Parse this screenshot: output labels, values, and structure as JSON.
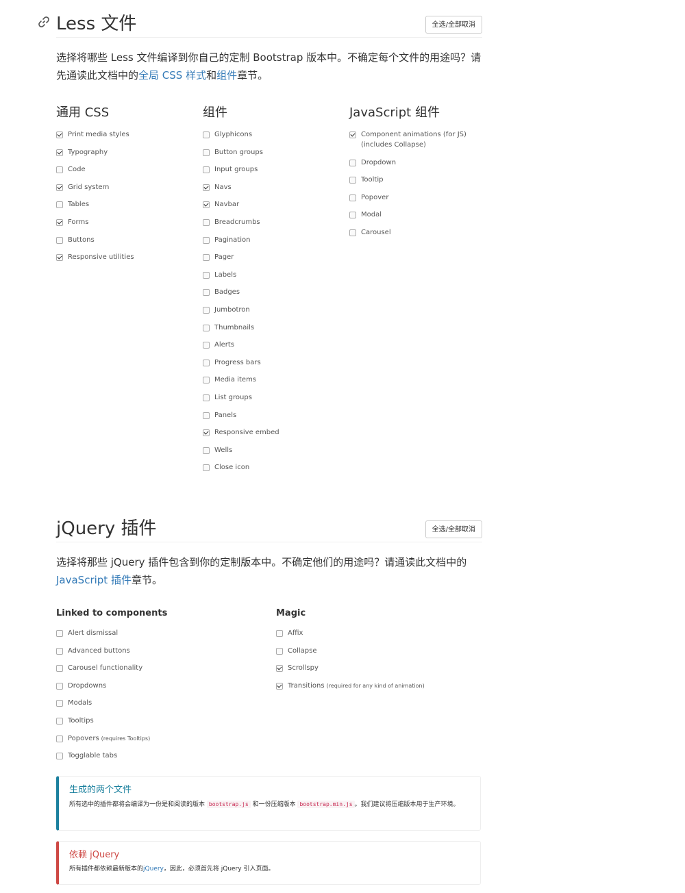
{
  "less": {
    "title": "Less 文件",
    "toggle_label": "全选/全部取消",
    "lead_pre": "选择将哪些 Less 文件编译到你自己的定制 Bootstrap 版本中。不确定每个文件的用途吗？请先通读此文档中的",
    "lead_link1": "全局 CSS 样式",
    "lead_mid": "和",
    "lead_link2": "组件",
    "lead_post": "章节。",
    "columns": [
      {
        "heading": "通用 CSS",
        "items": [
          {
            "label": "Print media styles",
            "checked": true
          },
          {
            "label": "Typography",
            "checked": true
          },
          {
            "label": "Code",
            "checked": false
          },
          {
            "label": "Grid system",
            "checked": true
          },
          {
            "label": "Tables",
            "checked": false
          },
          {
            "label": "Forms",
            "checked": true
          },
          {
            "label": "Buttons",
            "checked": false
          },
          {
            "label": "Responsive utilities",
            "checked": true
          }
        ]
      },
      {
        "heading": "组件",
        "items": [
          {
            "label": "Glyphicons",
            "checked": false
          },
          {
            "label": "Button groups",
            "checked": false
          },
          {
            "label": "Input groups",
            "checked": false
          },
          {
            "label": "Navs",
            "checked": true
          },
          {
            "label": "Navbar",
            "checked": true
          },
          {
            "label": "Breadcrumbs",
            "checked": false
          },
          {
            "label": "Pagination",
            "checked": false
          },
          {
            "label": "Pager",
            "checked": false
          },
          {
            "label": "Labels",
            "checked": false
          },
          {
            "label": "Badges",
            "checked": false
          },
          {
            "label": "Jumbotron",
            "checked": false
          },
          {
            "label": "Thumbnails",
            "checked": false
          },
          {
            "label": "Alerts",
            "checked": false
          },
          {
            "label": "Progress bars",
            "checked": false
          },
          {
            "label": "Media items",
            "checked": false
          },
          {
            "label": "List groups",
            "checked": false
          },
          {
            "label": "Panels",
            "checked": false
          },
          {
            "label": "Responsive embed",
            "checked": true
          },
          {
            "label": "Wells",
            "checked": false
          },
          {
            "label": "Close icon",
            "checked": false
          }
        ]
      },
      {
        "heading": "JavaScript 组件",
        "items": [
          {
            "label": "Component animations (for JS)",
            "label2": "(includes Collapse)",
            "checked": true
          },
          {
            "label": "Dropdown",
            "checked": false
          },
          {
            "label": "Tooltip",
            "checked": false
          },
          {
            "label": "Popover",
            "checked": false
          },
          {
            "label": "Modal",
            "checked": false
          },
          {
            "label": "Carousel",
            "checked": false
          }
        ]
      }
    ]
  },
  "jquery": {
    "title": "jQuery 插件",
    "toggle_label": "全选/全部取消",
    "lead_pre": "选择将那些 jQuery 插件包含到你的定制版本中。不确定他们的用途吗？请通读此文档中的",
    "lead_link": "JavaScript 插件",
    "lead_post": "章节。",
    "columns": [
      {
        "heading": "Linked to components",
        "items": [
          {
            "label": "Alert dismissal",
            "checked": false
          },
          {
            "label": "Advanced buttons",
            "checked": false
          },
          {
            "label": "Carousel functionality",
            "checked": false
          },
          {
            "label": "Dropdowns",
            "checked": false
          },
          {
            "label": "Modals",
            "checked": false
          },
          {
            "label": "Tooltips",
            "checked": false
          },
          {
            "label": "Popovers",
            "note": "(requires Tooltips)",
            "checked": false
          },
          {
            "label": "Togglable tabs",
            "checked": false
          }
        ]
      },
      {
        "heading": "Magic",
        "items": [
          {
            "label": "Affix",
            "checked": false
          },
          {
            "label": "Collapse",
            "checked": false
          },
          {
            "label": "Scrollspy",
            "checked": true
          },
          {
            "label": "Transitions",
            "note": "(required for any kind of animation)",
            "checked": true
          }
        ]
      }
    ]
  },
  "callout_info": {
    "title": "生成的两个文件",
    "text_pre": "所有选中的插件都将会编译为一份是和阅读的版本",
    "code1": "bootstrap.js",
    "text_mid": "和一份压缩版本",
    "code2": "bootstrap.min.js",
    "text_post": "。我们建议将压缩版本用于生产环境。",
    "color": "#1b809e"
  },
  "callout_danger": {
    "title": "依赖 jQuery",
    "text_pre": "所有插件都依赖最新版本的",
    "link": "jQuery",
    "text_post": "，因此，必须首先将 jQuery 引入页面。",
    "color": "#ce4844"
  }
}
